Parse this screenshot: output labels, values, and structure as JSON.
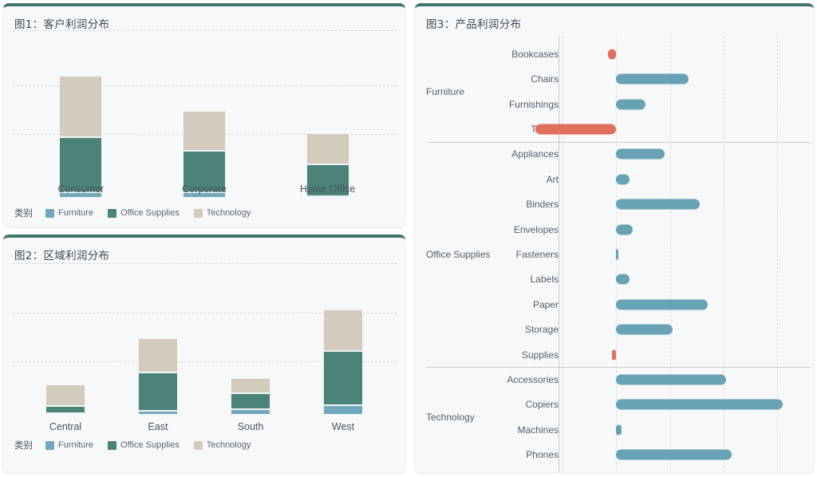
{
  "figure1": {
    "title": "图1：客户利润分布",
    "legend_title": "类别",
    "legend": [
      {
        "label": "Furniture",
        "color": "#72a8bd"
      },
      {
        "label": "Office Supplies",
        "color": "#4b8378"
      },
      {
        "label": "Technology",
        "color": "#d3ccbc"
      }
    ]
  },
  "figure2": {
    "title": "图2：区域利润分布",
    "legend_title": "类别",
    "legend": [
      {
        "label": "Furniture",
        "color": "#72a8bd"
      },
      {
        "label": "Office Supplies",
        "color": "#4b8378"
      },
      {
        "label": "Technology",
        "color": "#d3ccbc"
      }
    ]
  },
  "figure3": {
    "title": "图3：产品利润分布"
  },
  "chart_data": [
    {
      "type": "bar",
      "id": "fig1",
      "title": "图1：客户利润分布",
      "subtype": "stacked-vertical",
      "categories": [
        "Consumer",
        "Corporate",
        "Home Office"
      ],
      "series": [
        {
          "name": "Furniture",
          "color": "#72a8bd",
          "values": [
            6,
            6,
            2
          ]
        },
        {
          "name": "Office Supplies",
          "color": "#4b8378",
          "values": [
            56,
            42,
            32
          ]
        },
        {
          "name": "Technology",
          "color": "#d3ccbc",
          "values": [
            62,
            40,
            32
          ]
        }
      ],
      "xlabel": "",
      "ylabel": "",
      "ylim": [
        0,
        150
      ],
      "grid": true,
      "legend_position": "bottom-left",
      "legend_title": "类别"
    },
    {
      "type": "bar",
      "id": "fig2",
      "title": "图2：区域利润分布",
      "subtype": "stacked-vertical",
      "categories": [
        "Central",
        "East",
        "South",
        "West"
      ],
      "series": [
        {
          "name": "Furniture",
          "color": "#72a8bd",
          "values": [
            2,
            5,
            7,
            13
          ]
        },
        {
          "name": "Office Supplies",
          "color": "#4b8378",
          "values": [
            10,
            51,
            21,
            71
          ]
        },
        {
          "name": "Technology",
          "color": "#d3ccbc",
          "values": [
            28,
            45,
            21,
            55
          ]
        }
      ],
      "xlabel": "",
      "ylabel": "",
      "ylim": [
        0,
        190
      ],
      "grid": true,
      "legend_position": "bottom-left",
      "legend_title": "类别"
    },
    {
      "type": "bar",
      "id": "fig3",
      "title": "图3：产品利润分布",
      "subtype": "diverging-horizontal",
      "groups": [
        {
          "name": "Furniture",
          "items": [
            {
              "label": "Bookcases",
              "value": -3,
              "color": "#e0705c"
            },
            {
              "label": "Chairs",
              "value": 27,
              "color": "#67a2b5"
            },
            {
              "label": "Furnishings",
              "value": 11,
              "color": "#67a2b5"
            },
            {
              "label": "Tables",
              "value": -30,
              "color": "#e0705c"
            }
          ]
        },
        {
          "name": "Office Supplies",
          "items": [
            {
              "label": "Appliances",
              "value": 18,
              "color": "#67a2b5"
            },
            {
              "label": "Art",
              "value": 5,
              "color": "#67a2b5"
            },
            {
              "label": "Binders",
              "value": 31,
              "color": "#67a2b5"
            },
            {
              "label": "Envelopes",
              "value": 6,
              "color": "#67a2b5"
            },
            {
              "label": "Fasteners",
              "value": 0.3,
              "color": "#67a2b5"
            },
            {
              "label": "Labels",
              "value": 5,
              "color": "#67a2b5"
            },
            {
              "label": "Paper",
              "value": 34,
              "color": "#67a2b5"
            },
            {
              "label": "Storage",
              "value": 21,
              "color": "#67a2b5"
            },
            {
              "label": "Supplies",
              "value": -1.5,
              "color": "#e0705c"
            }
          ]
        },
        {
          "name": "Technology",
          "items": [
            {
              "label": "Accessories",
              "value": 41,
              "color": "#67a2b5"
            },
            {
              "label": "Copiers",
              "value": 62,
              "color": "#67a2b5"
            },
            {
              "label": "Machines",
              "value": 2,
              "color": "#67a2b5"
            },
            {
              "label": "Phones",
              "value": 43,
              "color": "#67a2b5"
            }
          ]
        }
      ],
      "xlim": [
        -20,
        70
      ],
      "gridline_values": [
        -20,
        0,
        20,
        40,
        60
      ],
      "grid": true,
      "zero_line": 0,
      "xlabel": "",
      "ylabel": ""
    }
  ]
}
